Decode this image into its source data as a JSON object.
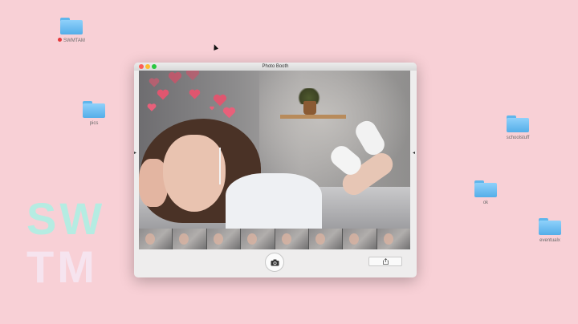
{
  "window": {
    "title": "Photo Booth"
  },
  "desktop": {
    "icons": [
      {
        "label": "SWMTAM",
        "tag_color": "#e5383b"
      },
      {
        "label": "pics"
      },
      {
        "label": "schoolstuff"
      },
      {
        "label": "ok"
      },
      {
        "label": "eventualx"
      }
    ],
    "watermark": {
      "line1": "SW",
      "line2": "TM"
    }
  },
  "photo_booth": {
    "effect": "hearts",
    "thumbnail_count": 8,
    "controls": {
      "capture": "camera-icon",
      "share": "share-icon"
    }
  },
  "colors": {
    "desktop_bg": "#f8d0d6",
    "folder": "#6bbdf2",
    "heart": "#e0566f",
    "watermark_top": "#b5ece2",
    "watermark_bottom": "#f6e4ef"
  }
}
